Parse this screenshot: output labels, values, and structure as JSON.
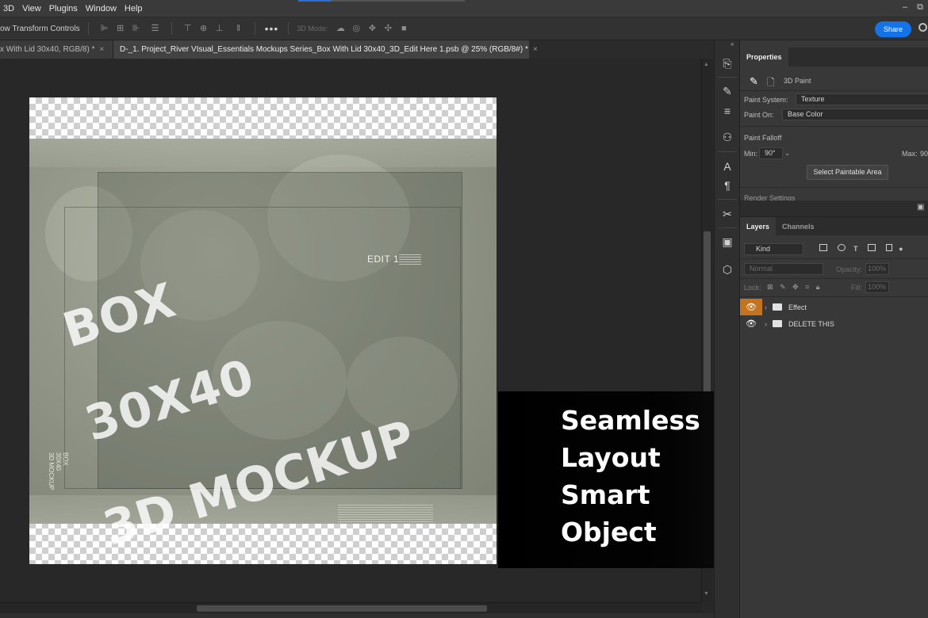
{
  "menu": {
    "items": [
      "3D",
      "View",
      "Plugins",
      "Window",
      "Help"
    ]
  },
  "window_controls": {
    "minimize": "–",
    "restore": "⧉"
  },
  "options_bar": {
    "transform_label": "ow Transform Controls",
    "more_label": "•••",
    "mode_label": "3D Mode:",
    "share_label": "Share"
  },
  "tabs": [
    {
      "label": "x With Lid 30x40, RGB/8) *",
      "close": "×"
    },
    {
      "label": "D-_1. Project_River VIsual_Essentials Mockups Series_Box With Lid 30x40_3D_Edit Here 1.psb @ 25% (RGB/8#) *",
      "close": "×"
    }
  ],
  "canvas": {
    "watermark_lines": [
      "BOX",
      "30X40",
      "3D MOCKUP"
    ],
    "edit_label": "EDIT 1",
    "side_text": [
      "BOX",
      "30X40",
      "3D MOCKUP"
    ]
  },
  "promo": {
    "lines": [
      "Seamless",
      "Layout",
      "Smart",
      "Object"
    ]
  },
  "properties_panel": {
    "tab": "Properties",
    "mode_label": "3D Paint",
    "paint_system_label": "Paint System:",
    "paint_system_value": "Texture",
    "paint_on_label": "Paint On:",
    "paint_on_value": "Base Color",
    "falloff_label": "Paint Falloff",
    "min_label": "Min:",
    "min_value": "90°",
    "max_label": "Max:",
    "max_value": "90",
    "select_button": "Select Paintable Area",
    "render_settings": "Render Settings"
  },
  "layers_panel": {
    "tabs": [
      "Layers",
      "Channels"
    ],
    "filter_value": "Kind",
    "blend_mode": "Normal",
    "opacity_label": "Opacity:",
    "opacity_value": "100%",
    "lock_label": "Lock:",
    "fill_label": "Fill:",
    "fill_value": "100%",
    "layers": [
      {
        "name": "Effect",
        "selected_eye": true
      },
      {
        "name": "DELETE THIS",
        "selected_eye": false
      }
    ]
  },
  "colors": {
    "accent": "#1473e6",
    "eye_highlight": "#c4731f",
    "panel_bg": "#383838"
  }
}
